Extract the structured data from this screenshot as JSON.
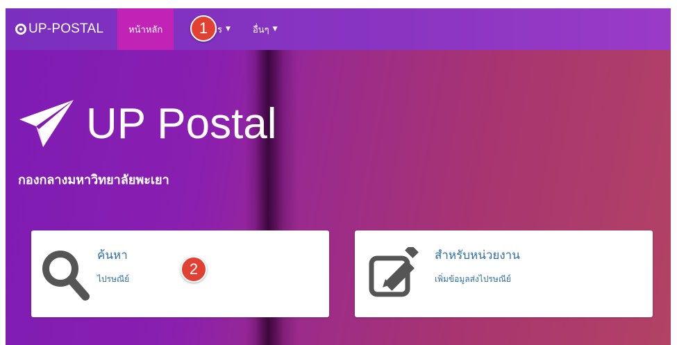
{
  "navbar": {
    "brand": "UP-POSTAL",
    "items": [
      {
        "label": "หน้าหลัก",
        "active": true
      },
      {
        "label": "ยการ",
        "dropdown": true
      },
      {
        "label": "อื่นๆ",
        "dropdown": true
      }
    ]
  },
  "hero": {
    "title": "UP Postal",
    "subtitle": "กองกลางมหาวิทยาลัยพะเยา",
    "icon": "paper-plane-icon"
  },
  "cards": [
    {
      "title": "ค้นหา",
      "subtitle": "ไปรษณีย์",
      "icon": "search-icon"
    },
    {
      "title": "สำหรับหน่วยงาน",
      "subtitle": "เพิ่มข้อมูลส่งไปรษณีย์",
      "icon": "edit-icon"
    }
  ],
  "markers": [
    "1",
    "2"
  ],
  "colors": {
    "navbar": "#8a35c2",
    "nav_active": "#c023b5",
    "link": "#2e6da4",
    "marker": "#e14132"
  }
}
